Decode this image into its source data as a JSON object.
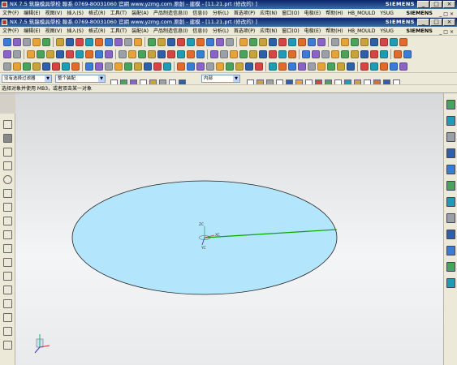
{
  "window": {
    "title": "NX 7.5 筑龍模具學校 聯系 0769-80031060 官網 www.yzmg.com 原創 - 建模 - [11.21.prt (修改的) ]",
    "brand": "SIEMENS",
    "menu_title": "NX 7.5 筑龍模具學校 聯系 0769-80031060 官網 www.yzmg.com 原創 - 建模 - [11.21.prt (修改的) ]"
  },
  "menus": [
    "文件(F)",
    "编辑(E)",
    "视图(V)",
    "插入(S)",
    "格式(R)",
    "工具(T)",
    "装配(A)",
    "产品制造信息(I)",
    "信息(I)",
    "分析(L)",
    "首选项(P)",
    "应用(N)",
    "窗口(O)",
    "电极(E)",
    "帮助(H)",
    "HB_MOULD",
    "YSUG"
  ],
  "selection_bar": {
    "filter": "没有选择过滤器",
    "assembly": "整个装配",
    "snap": "内部"
  },
  "status_prompt": "选择对象并使用 MB3，或者双击某一对象",
  "viewport": {
    "background_top": "#d7d8da",
    "ellipse_fill": "#b3e5fc",
    "line_color": "#00aa00",
    "triad_labels": {
      "z": "ZC",
      "x": "XC",
      "y": "YC"
    }
  },
  "icons": {
    "left_toolbar": [
      "sketch-icon",
      "profile-icon",
      "line-icon",
      "arc-icon",
      "circle-icon",
      "fillet-icon",
      "rectangle-icon",
      "polygon-icon",
      "studio-spline-icon",
      "point-icon",
      "offset-icon",
      "trim-icon",
      "extend-icon",
      "mirror-icon",
      "constraint-icon",
      "dimension-icon",
      "finish-sketch-icon"
    ],
    "right_toolbar": [
      "part-navigator-icon",
      "assembly-navigator-icon",
      "constraint-navigator-icon",
      "reuse-library-icon",
      "web-browser-icon",
      "history-icon",
      "system-materials-icon",
      "process-studio-icon",
      "roles-icon",
      "manufacturing-wizard-icon",
      "mold-wizard-icon",
      "palette-icon"
    ]
  }
}
